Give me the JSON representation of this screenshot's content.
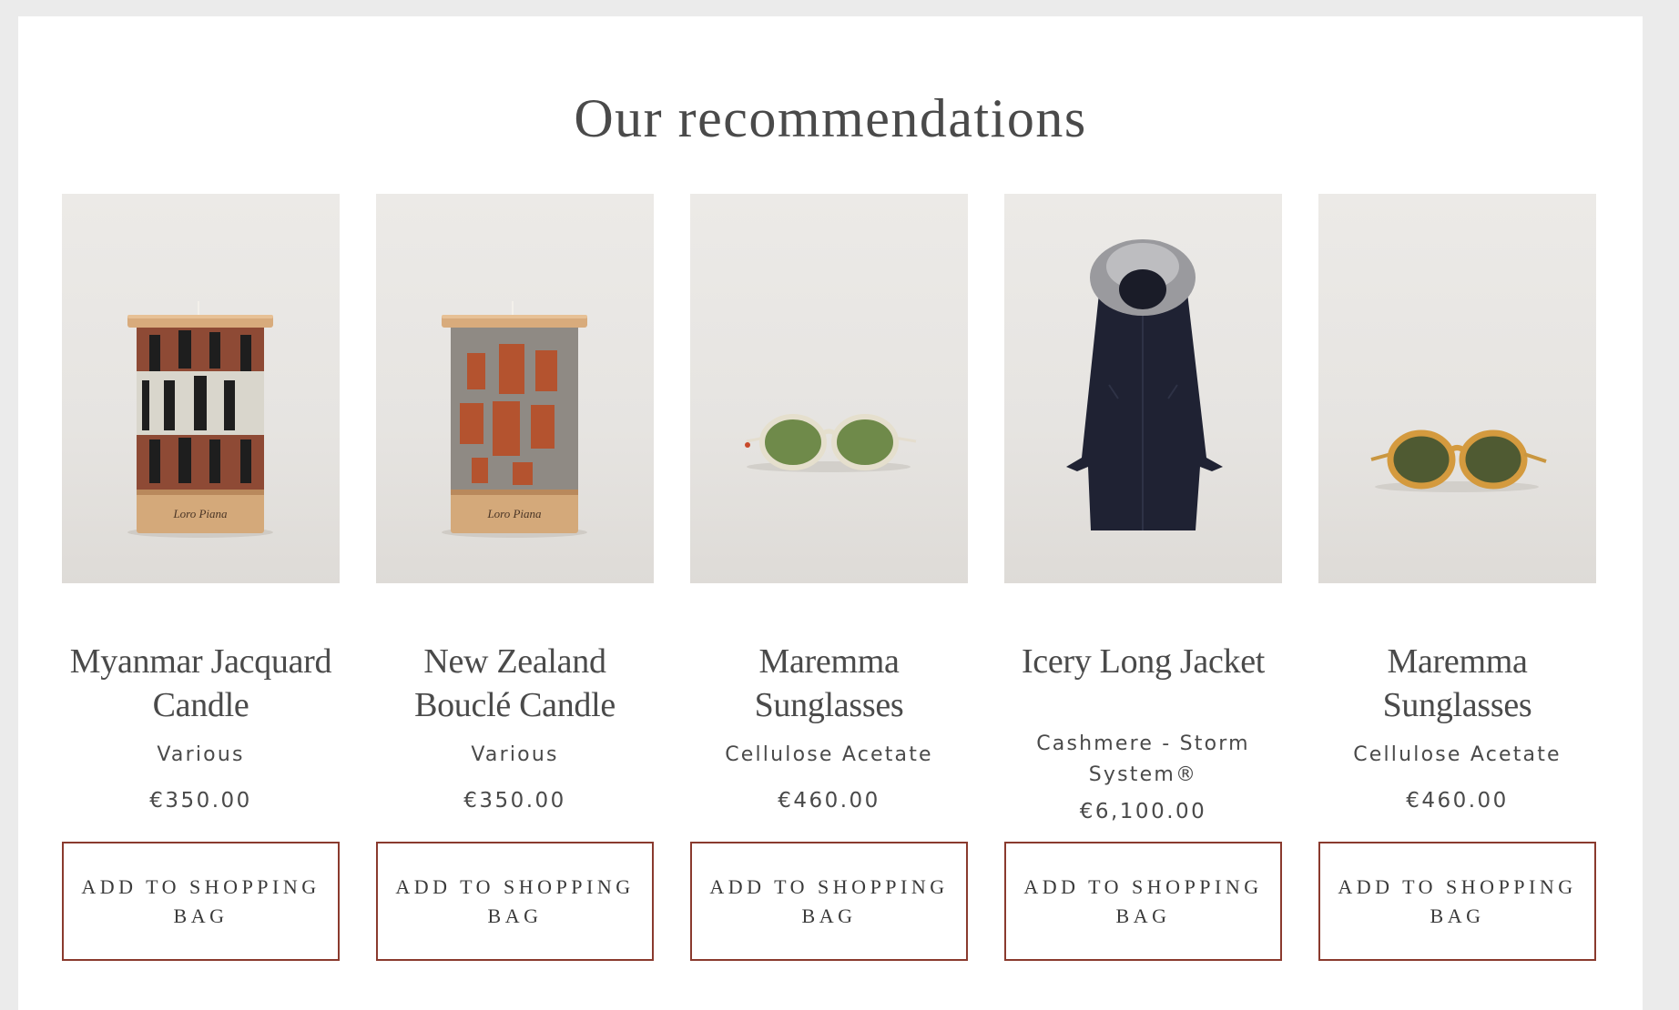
{
  "section": {
    "title": "Our recommendations"
  },
  "products": [
    {
      "name": "Myanmar Jacquard Candle",
      "material": "Various",
      "price": "€350.00",
      "button_label": "ADD TO SHOPPING BAG",
      "image_icon": "candle-striped-icon"
    },
    {
      "name": "New Zealand Bouclé Candle",
      "material": "Various",
      "price": "€350.00",
      "button_label": "ADD TO SHOPPING BAG",
      "image_icon": "candle-boucle-icon"
    },
    {
      "name": "Maremma Sunglasses",
      "material": "Cellulose Acetate",
      "price": "€460.00",
      "button_label": "ADD TO SHOPPING BAG",
      "image_icon": "sunglasses-clear-icon"
    },
    {
      "name": "Icery Long Jacket",
      "material": "Cashmere - Storm System®",
      "price": "€6,100.00",
      "button_label": "ADD TO SHOPPING BAG",
      "image_icon": "hooded-coat-icon"
    },
    {
      "name": "Maremma Sunglasses",
      "material": "Cellulose Acetate",
      "price": "€460.00",
      "button_label": "ADD TO SHOPPING BAG",
      "image_icon": "sunglasses-amber-icon"
    }
  ],
  "colors": {
    "page_background": "#ebebeb",
    "panel_background": "#ffffff",
    "text": "#4a4a4a",
    "button_border": "#8a3a2e"
  }
}
